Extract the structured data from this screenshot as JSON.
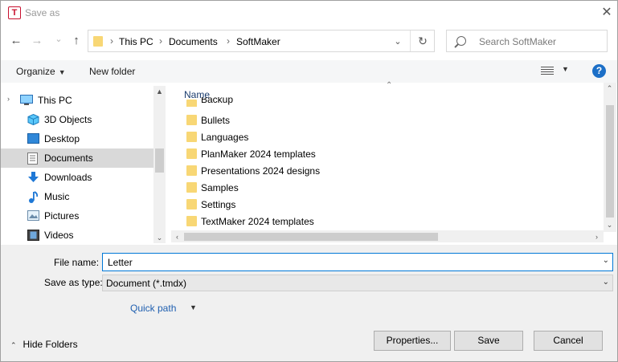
{
  "window": {
    "title": "Save as",
    "app_icon_letter": "T",
    "close_glyph": "✕"
  },
  "nav": {
    "back_glyph": "←",
    "forward_glyph": "→",
    "recent_glyph": "⌄",
    "up_glyph": "↑",
    "breadcrumb": [
      "This PC",
      "Documents",
      "SoftMaker"
    ],
    "separator": "›",
    "dropdown_glyph": "⌄",
    "refresh_glyph": "↻",
    "search_placeholder": "Search SoftMaker"
  },
  "toolbar": {
    "organize_label": "Organize",
    "caret": "▼",
    "new_folder_label": "New folder",
    "help_glyph": "?"
  },
  "sidebar": {
    "items": [
      {
        "label": "This PC",
        "icon": "computer-icon"
      },
      {
        "label": "3D Objects",
        "icon": "cube-icon"
      },
      {
        "label": "Desktop",
        "icon": "desktop-icon"
      },
      {
        "label": "Documents",
        "icon": "document-icon",
        "selected": true
      },
      {
        "label": "Downloads",
        "icon": "download-icon"
      },
      {
        "label": "Music",
        "icon": "music-icon"
      },
      {
        "label": "Pictures",
        "icon": "pictures-icon"
      },
      {
        "label": "Videos",
        "icon": "video-icon"
      }
    ],
    "expander_glyph": "›",
    "up_glyph": "▲",
    "down_glyph": "⌄"
  },
  "files": {
    "column_name": "Name",
    "sort_glyph": "⌃",
    "rows": [
      "Backup",
      "Bullets",
      "Languages",
      "PlanMaker 2024 templates",
      "Presentations 2024 designs",
      "Samples",
      "Settings",
      "TextMaker 2024 templates"
    ],
    "left_glyph": "‹",
    "right_glyph": "›",
    "up_glyph": "⌃",
    "down_glyph": "⌄"
  },
  "form": {
    "file_name_label": "File name:",
    "file_name_value": "Letter",
    "save_type_label": "Save as type:",
    "save_type_value": "Document (*.tmdx)",
    "dropdown_glyph": "⌄",
    "quick_path_label": "Quick path",
    "caret": "▼"
  },
  "footer": {
    "hide_folders_label": "Hide Folders",
    "hide_glyph": "⌃",
    "properties_label": "Properties...",
    "save_label": "Save",
    "cancel_label": "Cancel"
  }
}
